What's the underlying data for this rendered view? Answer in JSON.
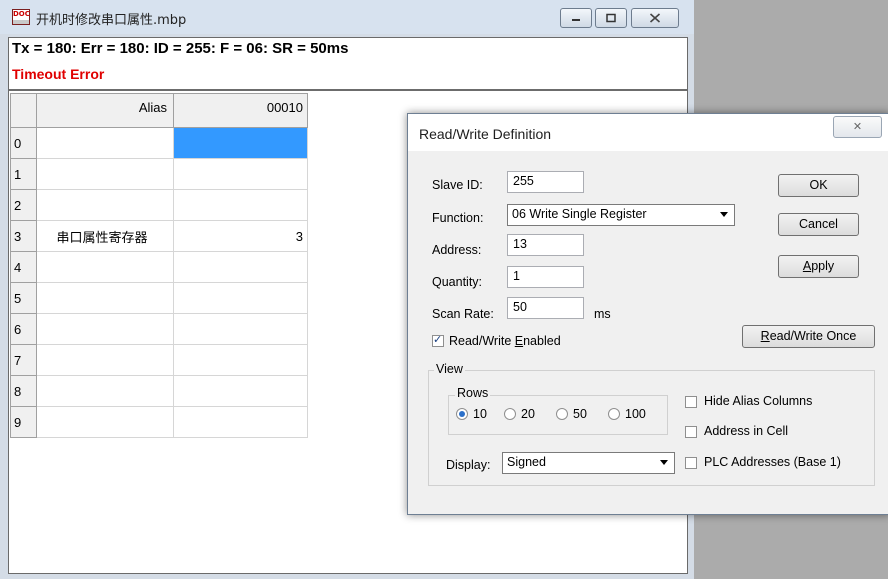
{
  "main_window": {
    "title": "开机时修改串口属性.mbp",
    "status_line": "Tx = 180: Err = 180: ID = 255: F = 06: SR = 50ms",
    "error_text": "Timeout Error"
  },
  "grid": {
    "alias_header": "Alias",
    "address_header": "00010",
    "rows": [
      {
        "num": "0",
        "alias": "",
        "value": ""
      },
      {
        "num": "1",
        "alias": "",
        "value": ""
      },
      {
        "num": "2",
        "alias": "",
        "value": ""
      },
      {
        "num": "3",
        "alias": "串口属性寄存器",
        "value": "3"
      },
      {
        "num": "4",
        "alias": "",
        "value": ""
      },
      {
        "num": "5",
        "alias": "",
        "value": ""
      },
      {
        "num": "6",
        "alias": "",
        "value": ""
      },
      {
        "num": "7",
        "alias": "",
        "value": ""
      },
      {
        "num": "8",
        "alias": "",
        "value": ""
      },
      {
        "num": "9",
        "alias": "",
        "value": ""
      }
    ]
  },
  "dialog": {
    "title": "Read/Write Definition",
    "slave_id_label": "Slave ID:",
    "slave_id": "255",
    "function_label": "Function:",
    "function": "06 Write Single Register",
    "address_label": "Address:",
    "address": "13",
    "quantity_label": "Quantity:",
    "quantity": "1",
    "scan_rate_label": "Scan Rate:",
    "scan_rate": "50",
    "scan_unit": "ms",
    "rw_enabled_pre": "Read/Write ",
    "rw_enabled_key": "E",
    "rw_enabled_post": "nabled",
    "rw_enabled_checked": true,
    "ok_label": "OK",
    "cancel_label": "Cancel",
    "apply_key": "A",
    "apply_rest": "pply",
    "rw_once_key": "R",
    "rw_once_rest": "ead/Write Once",
    "view_label": "View",
    "rows_label": "Rows",
    "row_options": [
      "10",
      "20",
      "50",
      "100"
    ],
    "rows_selected": "10",
    "display_label": "Display:",
    "display": "Signed",
    "hide_alias_label": "Hide Alias Columns",
    "address_in_cell_label": "Address in Cell",
    "plc_addresses_label": "PLC Addresses (Base 1)"
  },
  "colors": {
    "error": "#e00000",
    "selection": "#3399ff"
  }
}
